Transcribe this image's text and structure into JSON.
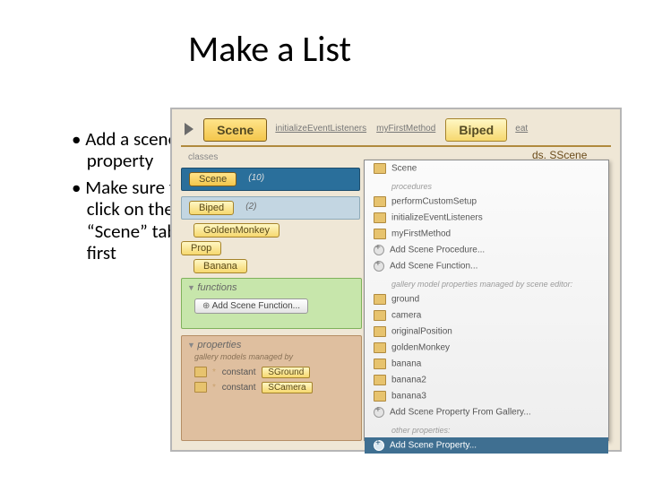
{
  "title": "Make a List",
  "bullets": [
    "Add a scene property",
    "Make sure to click on the “Scene” tab first"
  ],
  "top": {
    "sceneTab": "Scene",
    "m1": "initializeEventListeners",
    "m2": "myFirstMethod",
    "bipedTab": "Biped",
    "bipedMethod": "eat"
  },
  "classesLabel": "classes",
  "headerCut": "ds. SScene",
  "classes": {
    "scene": "Scene",
    "sceneCount": "(10)",
    "biped": "Biped",
    "bipedCount": "(2)",
    "golden": "GoldenMonkey",
    "prop": "Prop",
    "banana": "Banana"
  },
  "func": {
    "head": "functions",
    "add": "Add Scene Function..."
  },
  "props": {
    "head": "properties",
    "note": "gallery models managed by",
    "constLabel": "constant",
    "c1": "SGround",
    "c2": "SCamera"
  },
  "menu": {
    "secTop": "Scene",
    "procLabel": "procedures",
    "p1": "performCustomSetup",
    "p2": "initializeEventListeners",
    "p3": "myFirstMethod",
    "addProc": "Add Scene Procedure...",
    "addFunc": "Add Scene Function...",
    "galleryLabel": "gallery model properties managed by scene editor:",
    "g1": "ground",
    "g2": "camera",
    "g3": "originalPosition",
    "g4": "goldenMonkey",
    "g5": "banana",
    "g6": "banana2",
    "g7": "banana3",
    "addGallery": "Add Scene Property From Gallery...",
    "otherLabel": "other properties:",
    "addProp": "Add Scene Property..."
  }
}
